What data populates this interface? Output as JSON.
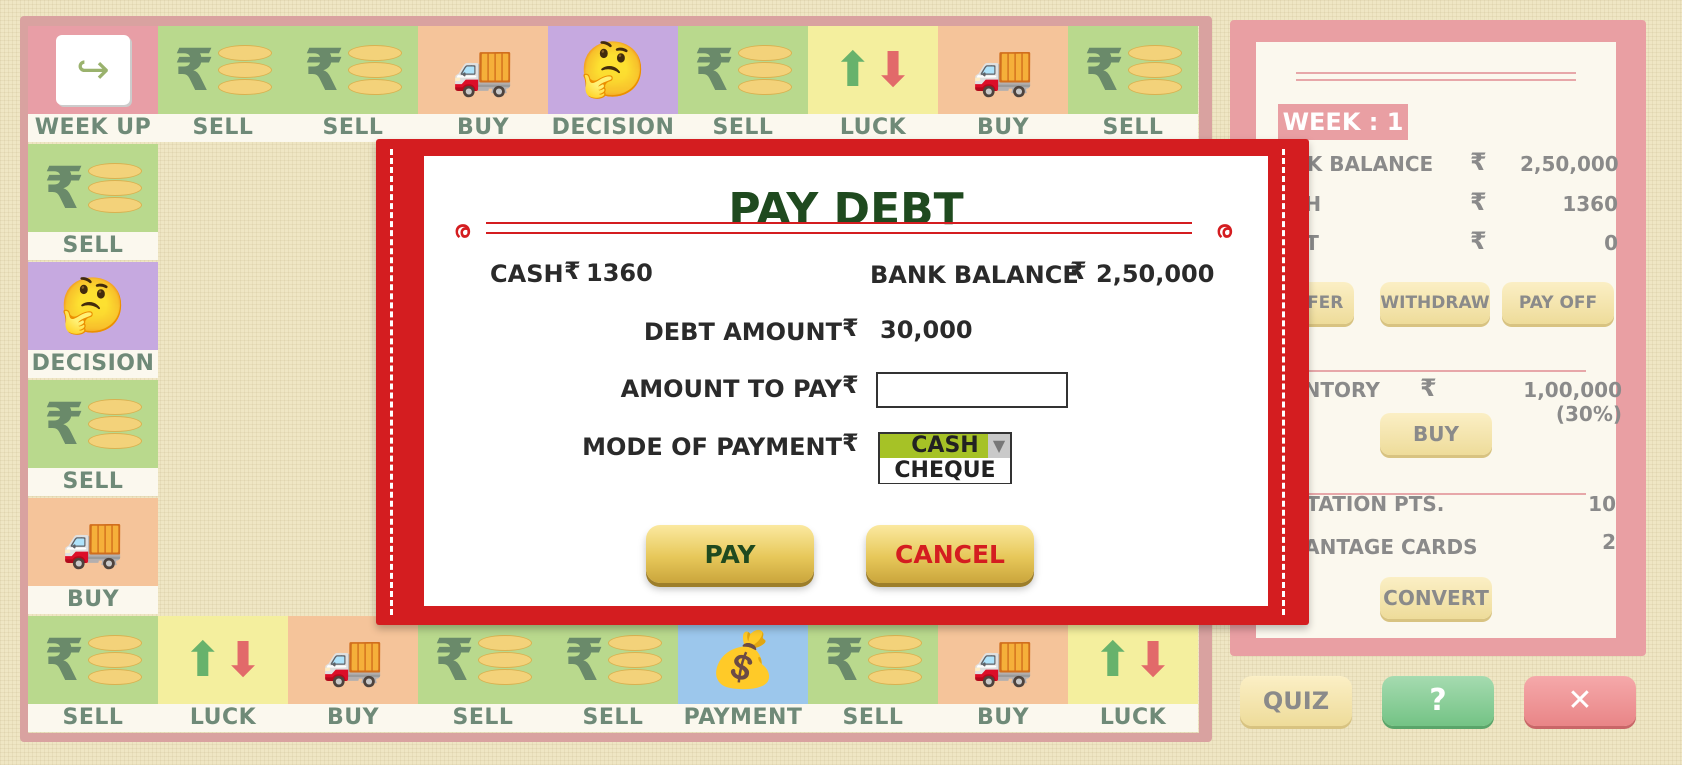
{
  "board": {
    "top_row": [
      {
        "label": "WEEK UP",
        "color": "red",
        "icon": "calendar-arrow-icon"
      },
      {
        "label": "SELL",
        "color": "green",
        "icon": "rupee-coins-icon"
      },
      {
        "label": "SELL",
        "color": "green",
        "icon": "rupee-coins-icon"
      },
      {
        "label": "BUY",
        "color": "orange",
        "icon": "truck-icon"
      },
      {
        "label": "DECISION",
        "color": "purple",
        "icon": "thinking-face-icon"
      },
      {
        "label": "SELL",
        "color": "green",
        "icon": "rupee-coins-icon"
      },
      {
        "label": "LUCK",
        "color": "yellow",
        "icon": "thumbs-arrows-icon"
      },
      {
        "label": "BUY",
        "color": "orange",
        "icon": "truck-icon"
      },
      {
        "label": "SELL",
        "color": "green",
        "icon": "rupee-coins-icon"
      }
    ],
    "left_column": [
      {
        "label": "SELL",
        "color": "green",
        "icon": "rupee-coins-icon"
      },
      {
        "label": "DECISION",
        "color": "purple",
        "icon": "thinking-face-icon"
      },
      {
        "label": "SELL",
        "color": "green",
        "icon": "rupee-coins-icon"
      },
      {
        "label": "BUY",
        "color": "orange",
        "icon": "truck-icon"
      }
    ],
    "bottom_row": [
      {
        "label": "SELL",
        "color": "green",
        "icon": "rupee-coins-icon"
      },
      {
        "label": "LUCK",
        "color": "yellow",
        "icon": "thumbs-arrows-icon"
      },
      {
        "label": "BUY",
        "color": "orange",
        "icon": "truck-icon"
      },
      {
        "label": "SELL",
        "color": "green",
        "icon": "rupee-coins-icon"
      },
      {
        "label": "SELL",
        "color": "green",
        "icon": "rupee-coins-icon"
      },
      {
        "label": "PAYMENT",
        "color": "blue",
        "icon": "moneybag-gavel-icon"
      },
      {
        "label": "SELL",
        "color": "green",
        "icon": "rupee-coins-icon"
      },
      {
        "label": "BUY",
        "color": "orange",
        "icon": "truck-icon"
      },
      {
        "label": "LUCK",
        "color": "yellow",
        "icon": "thumbs-arrows-icon"
      }
    ]
  },
  "panel": {
    "week": "WEEK : 1",
    "bank_balance_label": "NK BALANCE",
    "bank_balance_value": "2,50,000",
    "cash_label": "SH",
    "cash_value": "1360",
    "debt_label": "BT",
    "debt_value": "0",
    "currency": "₹",
    "transfer_label": "NSFER",
    "withdraw_label": "WITHDRAW",
    "payoff_label": "PAY OFF",
    "inventory_label": "ENTORY",
    "inventory_value": "1,00,000 (30%)",
    "buy_label": "BUY",
    "reputation_label": "UTATION PTS.",
    "reputation_value": "10",
    "advantage_label": "VANTAGE CARDS",
    "advantage_value": "2",
    "convert_label": "CONVERT",
    "quiz_label": "QUIZ",
    "help_label": "?",
    "close_label": "✕"
  },
  "modal": {
    "title": "PAY DEBT",
    "cash_label": "CASH",
    "cash_value": "1360",
    "bank_label": "BANK BALANCE",
    "bank_value": "2,50,000",
    "debt_label": "DEBT AMOUNT",
    "debt_value": "30,000",
    "amount_label": "AMOUNT TO PAY",
    "amount_value": "",
    "mode_label": "MODE OF PAYMENT",
    "currency": "₹",
    "mode_selected": "CASH",
    "mode_options": [
      "CASH",
      "CHEQUE"
    ],
    "pay_label": "PAY",
    "cancel_label": "CANCEL"
  },
  "colors": {
    "modal_red": "#d41d20",
    "title_green": "#1f4a1f",
    "cancel_red": "#d41d20",
    "select_green": "#a6c226",
    "gold": "#e7c85a"
  }
}
